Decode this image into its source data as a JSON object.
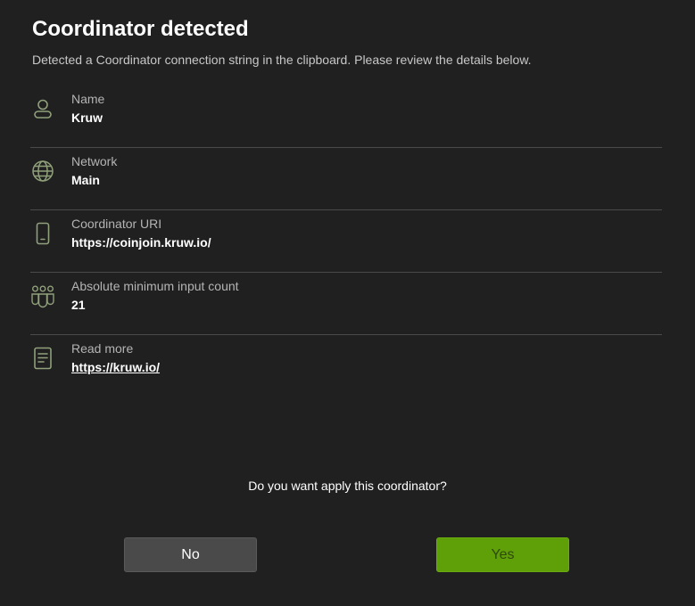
{
  "dialog": {
    "title": "Coordinator detected",
    "subtitle": "Detected a Coordinator connection string in the clipboard. Please review the details below."
  },
  "details": [
    {
      "icon": "person-icon",
      "label": "Name",
      "value": "Kruw"
    },
    {
      "icon": "globe-icon",
      "label": "Network",
      "value": "Main"
    },
    {
      "icon": "phone-icon",
      "label": "Coordinator URI",
      "value": "https://coinjoin.kruw.io/"
    },
    {
      "icon": "people-group-icon",
      "label": "Absolute minimum input count",
      "value": "21"
    },
    {
      "icon": "document-icon",
      "label": "Read more",
      "value": "https://kruw.io/"
    }
  ],
  "question": "Do you want apply this coordinator?",
  "buttons": {
    "no_label": "No",
    "yes_label": "Yes"
  },
  "colors": {
    "background": "#202020",
    "icon": "#8fa07a",
    "accent_green": "#5f9f08",
    "secondary_button": "#4a4a4a"
  }
}
